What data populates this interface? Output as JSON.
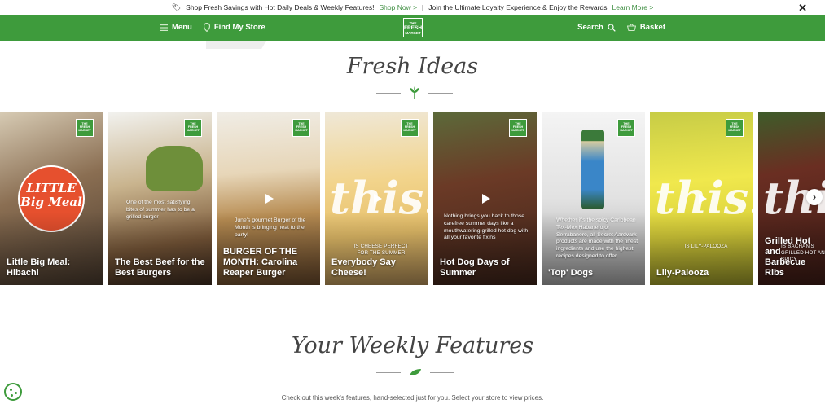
{
  "promo": {
    "text1": "Shop Fresh Savings with Hot Daily Deals & Weekly Features!",
    "link1": "Shop Now >",
    "separator": "|",
    "text2": "Join the Ultimate Loyalty Experience & Enjoy the Rewards",
    "link2": "Learn More >",
    "close": "✕"
  },
  "nav": {
    "menu": "Menu",
    "find_store": "Find My Store",
    "logo_top": "THE",
    "logo_main": "FRESH",
    "logo_bottom": "MARKET",
    "search": "Search",
    "basket": "Basket"
  },
  "colors": {
    "brand_green": "#3e9b3c",
    "link_green": "#3e8e41"
  },
  "fresh_ideas": {
    "heading": "Fresh Ideas",
    "cards": [
      {
        "title": "Little Big Meal: Hibachi",
        "overlay": "LITTLE Big Meal",
        "bg": "#7c6a55"
      },
      {
        "title": "The Best Beef for the Best Burgers",
        "desc": "One of the most satisfying bites of summer has to be a grilled burger",
        "bg": "#a08c6c"
      },
      {
        "title": "BURGER OF THE MONTH: Carolina Reaper Burger",
        "desc": "June's gourmet Burger of the Month is bringing heat to the party!",
        "bg": "#b89968"
      },
      {
        "title": "Everybody Say Cheese!",
        "desc": "IS CHEESE PERFECT FOR THE SUMMER",
        "script": "this!",
        "bg": "#e4c98a"
      },
      {
        "title": "Hot Dog Days of Summer",
        "desc": "Nothing brings you back to those carefree summer days like a mouthwatering grilled hot dog with all your favorite fixins",
        "bg": "#5e3a2a"
      },
      {
        "title": "'Top' Dogs",
        "desc": "Whether it's the spicy Caribbean Tex-Mex Habanero or Serrabanero, all Secret Aardvark products are made with the finest ingredients and use the highest recipes designed to offer",
        "bg": "#dcdcdc"
      },
      {
        "title": "Lily-Palooza",
        "desc": "IS LILY-PALOOZA",
        "script": "this!",
        "bg": "#d8d64a"
      },
      {
        "title": "Grilled Hot and Barbecue Ribs",
        "desc": "IS BACHAN'S GRILLED HOT AND SPICY",
        "script": "this!",
        "bg": "#5a2a22"
      }
    ],
    "brand_top": "THE",
    "brand_main": "FRESH",
    "brand_bottom": "MARKET",
    "next_icon": "›"
  },
  "weekly": {
    "heading": "Your Weekly Features",
    "description": "Check out this week's features, hand-selected just for you. Select your store to view prices."
  }
}
